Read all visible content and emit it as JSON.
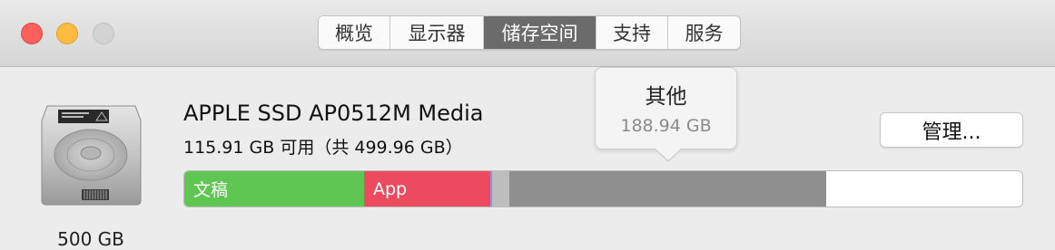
{
  "window": {
    "traffic_lights": [
      "close",
      "minimize",
      "zoom"
    ],
    "tabs": [
      {
        "label": "概览",
        "active": false
      },
      {
        "label": "显示器",
        "active": false
      },
      {
        "label": "储存空间",
        "active": true
      },
      {
        "label": "支持",
        "active": false
      },
      {
        "label": "服务",
        "active": false
      }
    ]
  },
  "disk": {
    "icon": "hard-drive-icon",
    "capacity_label": "500 GB",
    "name": "APPLE SSD AP0512M Media",
    "available": "115.91 GB 可用（共 499.96 GB）"
  },
  "manage_button": {
    "label": "管理..."
  },
  "storage_bar": {
    "segments": [
      {
        "name": "documents",
        "label": "文稿",
        "color": "#5fc653",
        "fraction": 0.214
      },
      {
        "name": "apps",
        "label": "App",
        "color": "#ec4a5e",
        "fraction": 0.151
      },
      {
        "name": "system-purple",
        "label": "",
        "color": "#9e8dd7",
        "fraction": 0.002
      },
      {
        "name": "system",
        "label": "",
        "color": "#bdbdbd",
        "fraction": 0.021
      },
      {
        "name": "other",
        "label": "",
        "color": "#8f8f8f",
        "fraction": 0.378
      }
    ],
    "free_color": "#ffffff"
  },
  "tooltip": {
    "title": "其他",
    "value": "188.94 GB"
  }
}
